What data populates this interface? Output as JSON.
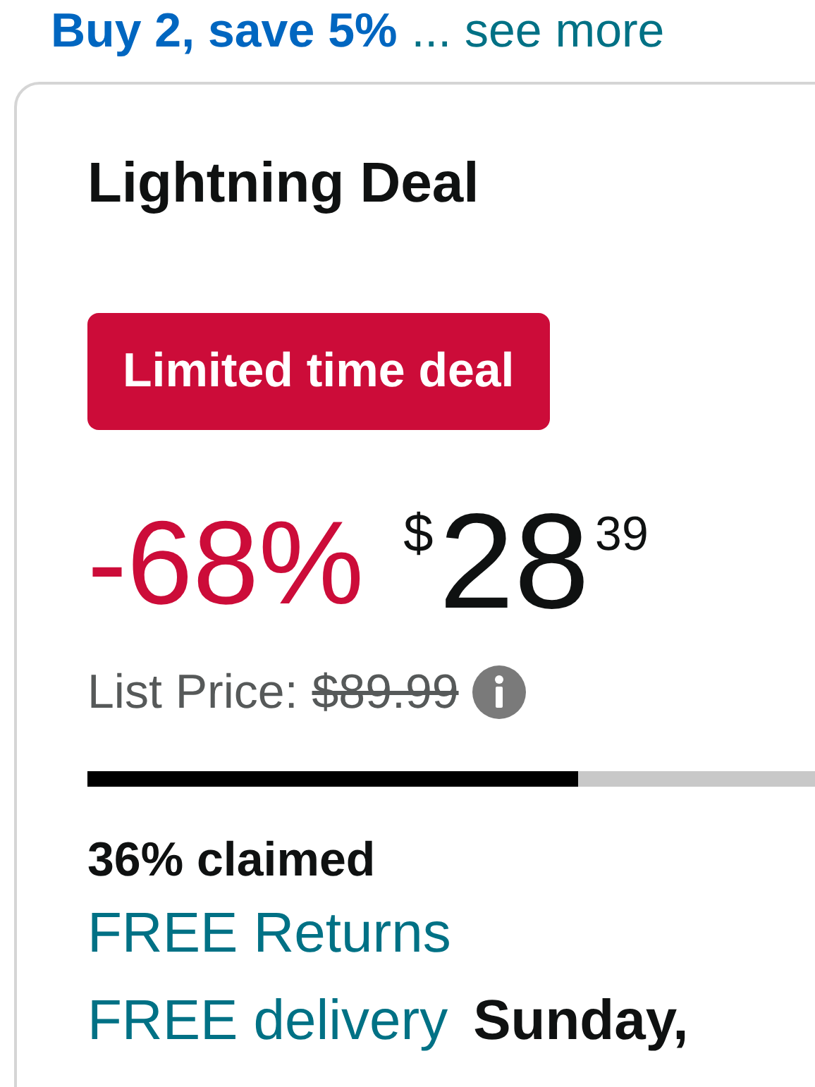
{
  "promo": {
    "offer": "Buy 2, save 5%",
    "link": "... see more"
  },
  "deal": {
    "title": "Lightning Deal",
    "badge": "Limited time deal",
    "discount": "-68%",
    "currency": "$",
    "whole": "28",
    "fraction": "39",
    "list_label": "List Price:",
    "list_price": "$89.99",
    "claimed": {
      "level": 0.674,
      "text": "36% claimed"
    },
    "returns": "FREE Returns",
    "delivery": "FREE delivery",
    "delivery_date": "Sunday,"
  }
}
